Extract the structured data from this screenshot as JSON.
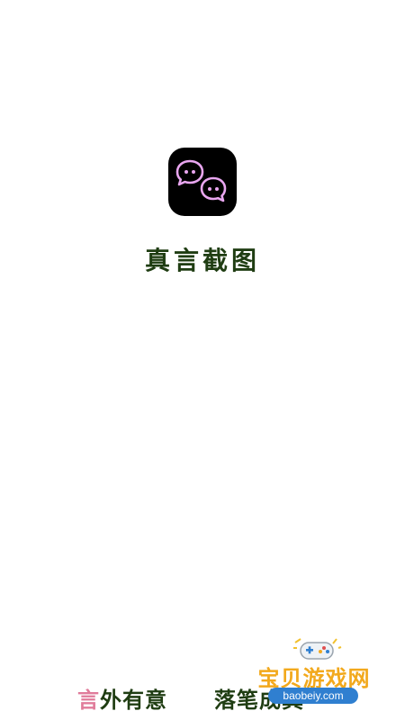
{
  "app": {
    "name": "真言截图",
    "icon": "chat-bubbles-icon",
    "icon_color": "#e9a6f0",
    "icon_background": "#000000",
    "name_color": "#1f3d12"
  },
  "slogan": {
    "part1_accent": "言",
    "part1_rest": "外有意",
    "part2": "落笔成真",
    "accent_color": "#e07b9a"
  },
  "watermark": {
    "title": "宝贝游戏网",
    "url": "baobeiy.com",
    "icon": "gamepad-icon"
  }
}
